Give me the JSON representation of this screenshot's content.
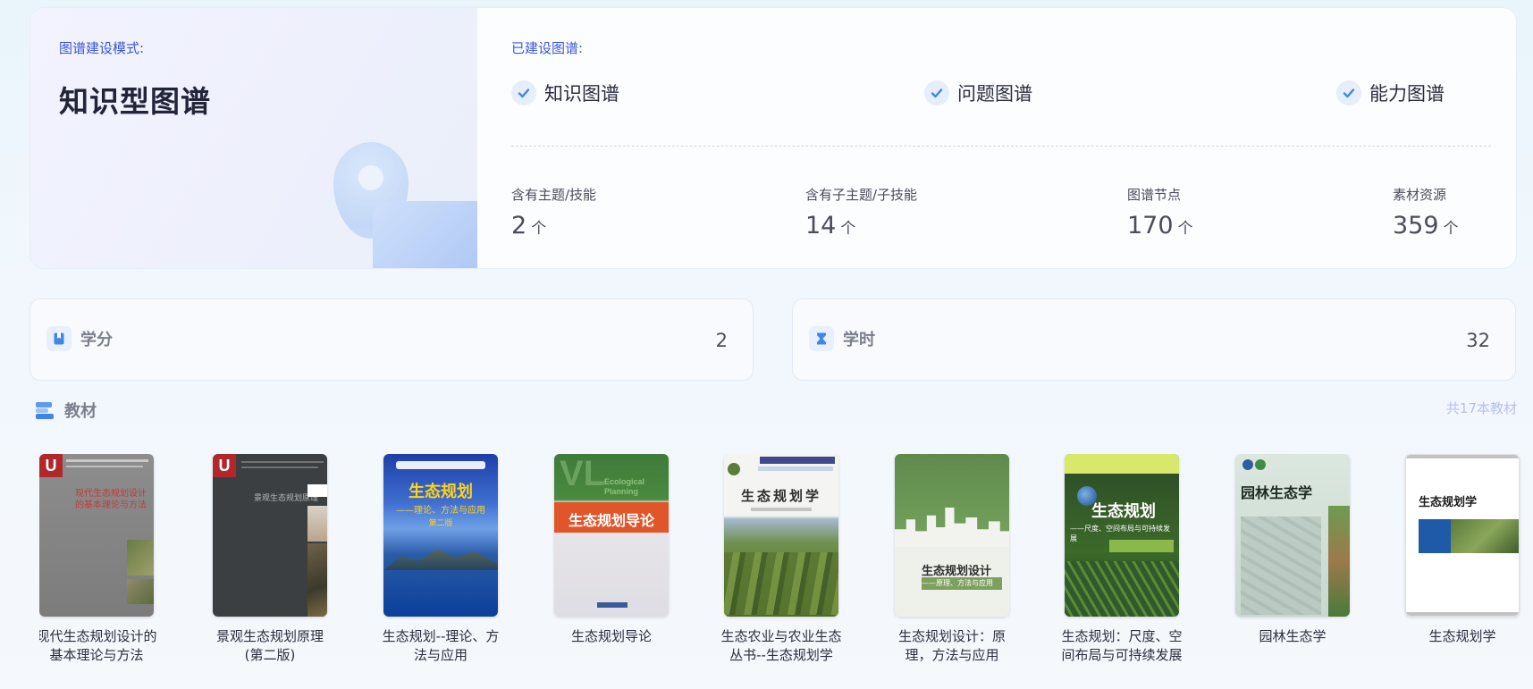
{
  "mode": {
    "label": "图谱建设模式:",
    "title": "知识型图谱"
  },
  "built": {
    "label": "已建设图谱:",
    "types": [
      "知识图谱",
      "问题图谱",
      "能力图谱"
    ]
  },
  "stats": [
    {
      "label": "含有主题/技能",
      "value": "2",
      "unit": "个"
    },
    {
      "label": "含有子主题/子技能",
      "value": "14",
      "unit": "个"
    },
    {
      "label": "图谱节点",
      "value": "170",
      "unit": "个"
    },
    {
      "label": "素材资源",
      "value": "359",
      "unit": "个"
    }
  ],
  "credits": {
    "label": "学分",
    "value": "2"
  },
  "hours": {
    "label": "学时",
    "value": "32"
  },
  "textbooks": {
    "title": "教材",
    "count": "共17本教材",
    "books": [
      {
        "title": "现代生态规划设计的基本理论与方法",
        "cover": "现代生态规划设计的基本理论与方法"
      },
      {
        "title": "景观生态规划原理(第二版)",
        "cover": "景观生态规划原理"
      },
      {
        "title": "生态规划--理论、方法与应用",
        "cover": "生态规划",
        "cover_sub": "——理论、方法与应用",
        "cover_ed": "第二版"
      },
      {
        "title": "生态规划导论",
        "cover": "生态规划导论",
        "cover_en": "Ecological Planning"
      },
      {
        "title": "生态农业与农业生态丛书--生态规划学",
        "cover": "生态规划学"
      },
      {
        "title": "生态规划设计：原理，方法与应用",
        "cover": "生态规划设计",
        "cover_sub": "——原理、方法与应用"
      },
      {
        "title": "生态规划：尺度、空间布局与可持续发展",
        "cover": "生态规划",
        "cover_sub": "——尺度、空间布局与可持续发展"
      },
      {
        "title": "园林生态学",
        "cover": "园林生态学"
      },
      {
        "title": "生态规划学",
        "cover": "生态规划学"
      }
    ]
  },
  "colors": {
    "accent": "#3a57d6",
    "check": "#3f86e8",
    "muted": "#7b7f8c"
  }
}
